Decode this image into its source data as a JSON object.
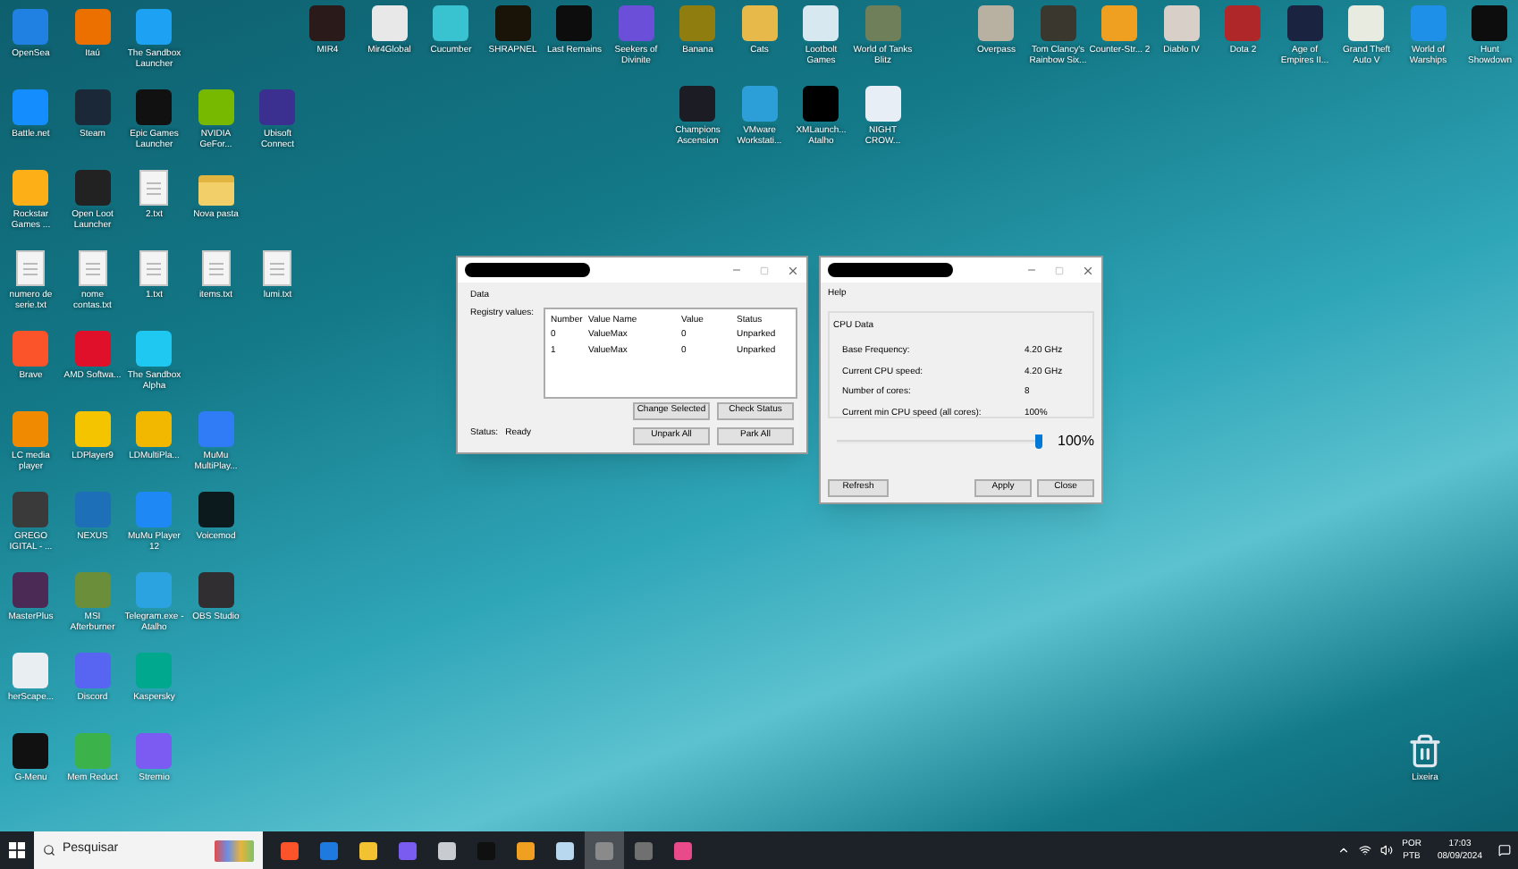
{
  "desktop": {
    "left_grid": [
      [
        {
          "label": "OpenSea",
          "kind": "app",
          "color": "#2081e2"
        },
        {
          "label": "Itaú",
          "kind": "app",
          "color": "#ec7000"
        },
        {
          "label": "The Sandbox Launcher",
          "kind": "app",
          "color": "#1da1f2"
        }
      ],
      [
        {
          "label": "Battle.net",
          "kind": "app",
          "color": "#148eff"
        },
        {
          "label": "Steam",
          "kind": "app",
          "color": "#1b2838"
        },
        {
          "label": "Epic Games Launcher",
          "kind": "app",
          "color": "#111111"
        },
        {
          "label": "NVIDIA GeFor...",
          "kind": "app",
          "color": "#76b900"
        },
        {
          "label": "Ubisoft Connect",
          "kind": "app",
          "color": "#3b2f8f"
        }
      ],
      [
        {
          "label": "Rockstar Games ...",
          "kind": "app",
          "color": "#fcaf17"
        },
        {
          "label": "Open Loot Launcher",
          "kind": "app",
          "color": "#222222"
        },
        {
          "label": "2.txt",
          "kind": "text_file"
        },
        {
          "label": "Nova pasta",
          "kind": "folder"
        }
      ],
      [
        {
          "label": "numero de serie.txt",
          "kind": "text_file"
        },
        {
          "label": "nome contas.txt",
          "kind": "text_file"
        },
        {
          "label": "1.txt",
          "kind": "text_file"
        },
        {
          "label": "items.txt",
          "kind": "text_file"
        },
        {
          "label": "lumi.txt",
          "kind": "text_file"
        }
      ],
      [
        {
          "label": "Brave",
          "kind": "app",
          "color": "#fb542b"
        },
        {
          "label": "AMD Softwa...",
          "kind": "app",
          "color": "#e0102b"
        },
        {
          "label": "The Sandbox Alpha",
          "kind": "app",
          "color": "#1ec8f0"
        }
      ],
      [
        {
          "label": "LC media player",
          "kind": "app",
          "color": "#f08a00"
        },
        {
          "label": "LDPlayer9",
          "kind": "app",
          "color": "#f5c400"
        },
        {
          "label": "LDMultiPla...",
          "kind": "app",
          "color": "#f2b800"
        },
        {
          "label": "MuMu MultiPlay...",
          "kind": "app",
          "color": "#2f7cf6"
        }
      ],
      [
        {
          "label": "GREGO IGITAL - ...",
          "kind": "app",
          "color": "#3a3a3a"
        },
        {
          "label": "NEXUS",
          "kind": "app",
          "color": "#1d6fb8"
        },
        {
          "label": "MuMu Player 12",
          "kind": "app",
          "color": "#1e88f5"
        },
        {
          "label": "Voicemod",
          "kind": "app",
          "color": "#0c1a1e"
        }
      ],
      [
        {
          "label": "MasterPlus",
          "kind": "app",
          "color": "#4b2a55"
        },
        {
          "label": "MSI Afterburner",
          "kind": "app",
          "color": "#6b8e3a"
        },
        {
          "label": "Telegram.exe - Atalho",
          "kind": "app",
          "color": "#2aa3e0"
        },
        {
          "label": "OBS Studio",
          "kind": "app",
          "color": "#302e31"
        }
      ],
      [
        {
          "label": "herScape...",
          "kind": "app",
          "color": "#e9eef2"
        },
        {
          "label": "Discord",
          "kind": "app",
          "color": "#5865f2"
        },
        {
          "label": "Kaspersky",
          "kind": "app",
          "color": "#00a88e"
        }
      ],
      [
        {
          "label": "G-Menu",
          "kind": "app",
          "color": "#111111"
        },
        {
          "label": "Mem Reduct",
          "kind": "app",
          "color": "#3bb34a"
        },
        {
          "label": "Stremio",
          "kind": "app",
          "color": "#7b5bf2"
        }
      ]
    ],
    "top_row": [
      {
        "label": "MIR4",
        "kind": "app",
        "color": "#2a1a1a"
      },
      {
        "label": "Mir4Global",
        "kind": "app",
        "color": "#e8e8e8"
      },
      {
        "label": "Cucumber",
        "kind": "app",
        "color": "#39c3d0"
      },
      {
        "label": "SHRAPNEL",
        "kind": "app",
        "color": "#1a1408"
      },
      {
        "label": "Last Remains",
        "kind": "app",
        "color": "#0d0d0d"
      },
      {
        "label": "Seekers of Divinite",
        "kind": "app",
        "color": "#6b4fd8"
      },
      {
        "label": "Banana",
        "kind": "app",
        "color": "#8f7d10"
      },
      {
        "label": "Cats",
        "kind": "app",
        "color": "#e6b94a"
      },
      {
        "label": "Lootbolt Games",
        "kind": "app",
        "color": "#d8e8f0"
      },
      {
        "label": "World of Tanks Blitz",
        "kind": "app",
        "color": "#6f7f5a"
      }
    ],
    "top_row_2": [
      {
        "label": "Champions Ascension",
        "kind": "app",
        "color": "#1c1c24"
      },
      {
        "label": "VMware Workstati...",
        "kind": "app",
        "color": "#2c9fd8"
      },
      {
        "label": "XMLaunch... Atalho",
        "kind": "app",
        "color": "#000000"
      },
      {
        "label": "NIGHT CROW...",
        "kind": "app",
        "color": "#e8eef6"
      }
    ],
    "top_right": [
      {
        "label": "Overpass",
        "kind": "app",
        "color": "#b8b0a0"
      },
      {
        "label": "Tom Clancy's Rainbow Six...",
        "kind": "app",
        "color": "#3a382e"
      },
      {
        "label": "Counter-Str... 2",
        "kind": "app",
        "color": "#f0a020"
      },
      {
        "label": "Diablo IV",
        "kind": "app",
        "color": "#d8d0c8"
      },
      {
        "label": "Dota 2",
        "kind": "app",
        "color": "#b0272a"
      },
      {
        "label": "Age of Empires II...",
        "kind": "app",
        "color": "#1a2440"
      },
      {
        "label": "Grand Theft Auto V",
        "kind": "app",
        "color": "#e8ece0"
      },
      {
        "label": "World of Warships",
        "kind": "app",
        "color": "#1e90e8"
      },
      {
        "label": "Hunt Showdown",
        "kind": "app",
        "color": "#0d0d0d"
      }
    ],
    "recycle_bin": {
      "label": "Lixeira"
    }
  },
  "registry_window": {
    "group": "Data",
    "list_label": "Registry values:",
    "columns": [
      "Number",
      "Value Name",
      "Value",
      "Status"
    ],
    "rows": [
      [
        "0",
        "ValueMax",
        "0",
        "Unparked"
      ],
      [
        "1",
        "ValueMax",
        "0",
        "Unparked"
      ]
    ],
    "buttons": [
      "Change Selected",
      "Check Status",
      "Unpark All",
      "Park All"
    ],
    "status_label": "Status:",
    "status": "Ready"
  },
  "cpu_window": {
    "menu": [
      "Help"
    ],
    "group": "CPU Data",
    "fields": [
      {
        "label": "Base Frequency:",
        "value": "4.20 GHz"
      },
      {
        "label": "Current CPU speed:",
        "value": "4.20 GHz"
      },
      {
        "label": "Number of cores:",
        "value": "8"
      },
      {
        "label": "Current min CPU speed (all cores):",
        "value": "100%"
      }
    ],
    "slider": {
      "level": 1.0,
      "reading": "100%"
    },
    "buttons": [
      "Refresh",
      "Apply",
      "Close"
    ]
  },
  "taskbar": {
    "search_placeholder": "Pesquisar",
    "apps": [
      {
        "selected": false,
        "color": "#fb542b"
      },
      {
        "selected": false,
        "color": "#1f7ae0"
      },
      {
        "selected": false,
        "color": "#f2c230"
      },
      {
        "selected": false,
        "color": "#7a5cf0"
      },
      {
        "selected": false,
        "color": "#c8ccd0"
      },
      {
        "selected": false,
        "color": "#101010"
      },
      {
        "selected": false,
        "color": "#f0a020"
      },
      {
        "selected": false,
        "color": "#b8d8f0"
      },
      {
        "selected": true,
        "color": "#8a8a8a"
      },
      {
        "selected": false,
        "color": "#707070"
      },
      {
        "selected": false,
        "color": "#e84a8a"
      }
    ],
    "language": "POR",
    "layout": "PTB",
    "time": "17:03",
    "date": "08/09/2024"
  }
}
